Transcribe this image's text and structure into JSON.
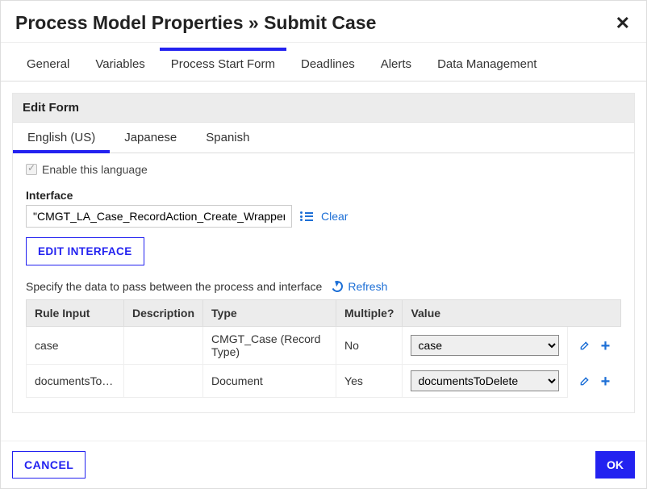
{
  "header": {
    "title": "Process Model Properties » Submit Case"
  },
  "tabs": {
    "items": [
      {
        "label": "General"
      },
      {
        "label": "Variables"
      },
      {
        "label": "Process Start Form"
      },
      {
        "label": "Deadlines"
      },
      {
        "label": "Alerts"
      },
      {
        "label": "Data Management"
      }
    ],
    "active_index": 2
  },
  "panel": {
    "title": "Edit Form",
    "lang_tabs": [
      {
        "label": "English (US)"
      },
      {
        "label": "Japanese"
      },
      {
        "label": "Spanish"
      }
    ],
    "lang_active_index": 0,
    "enable_checkbox": {
      "label": "Enable this language",
      "checked": true
    },
    "interface": {
      "label": "Interface",
      "value": "\"CMGT_LA_Case_RecordAction_Create_Wrapper\"",
      "clear": "Clear",
      "edit_button": "EDIT INTERFACE"
    },
    "pass_text": "Specify the data to pass between the process and interface",
    "refresh": "Refresh",
    "table": {
      "headers": {
        "rule_input": "Rule Input",
        "description": "Description",
        "type": "Type",
        "multiple": "Multiple?",
        "value": "Value"
      },
      "rows": [
        {
          "rule_input": "case",
          "description": "",
          "type": "CMGT_Case (Record Type)",
          "multiple": "No",
          "value": "case"
        },
        {
          "rule_input": "documentsToDelete",
          "description": "",
          "type": "Document",
          "multiple": "Yes",
          "value": "documentsToDelete"
        }
      ]
    }
  },
  "footer": {
    "cancel": "CANCEL",
    "ok": "OK"
  }
}
